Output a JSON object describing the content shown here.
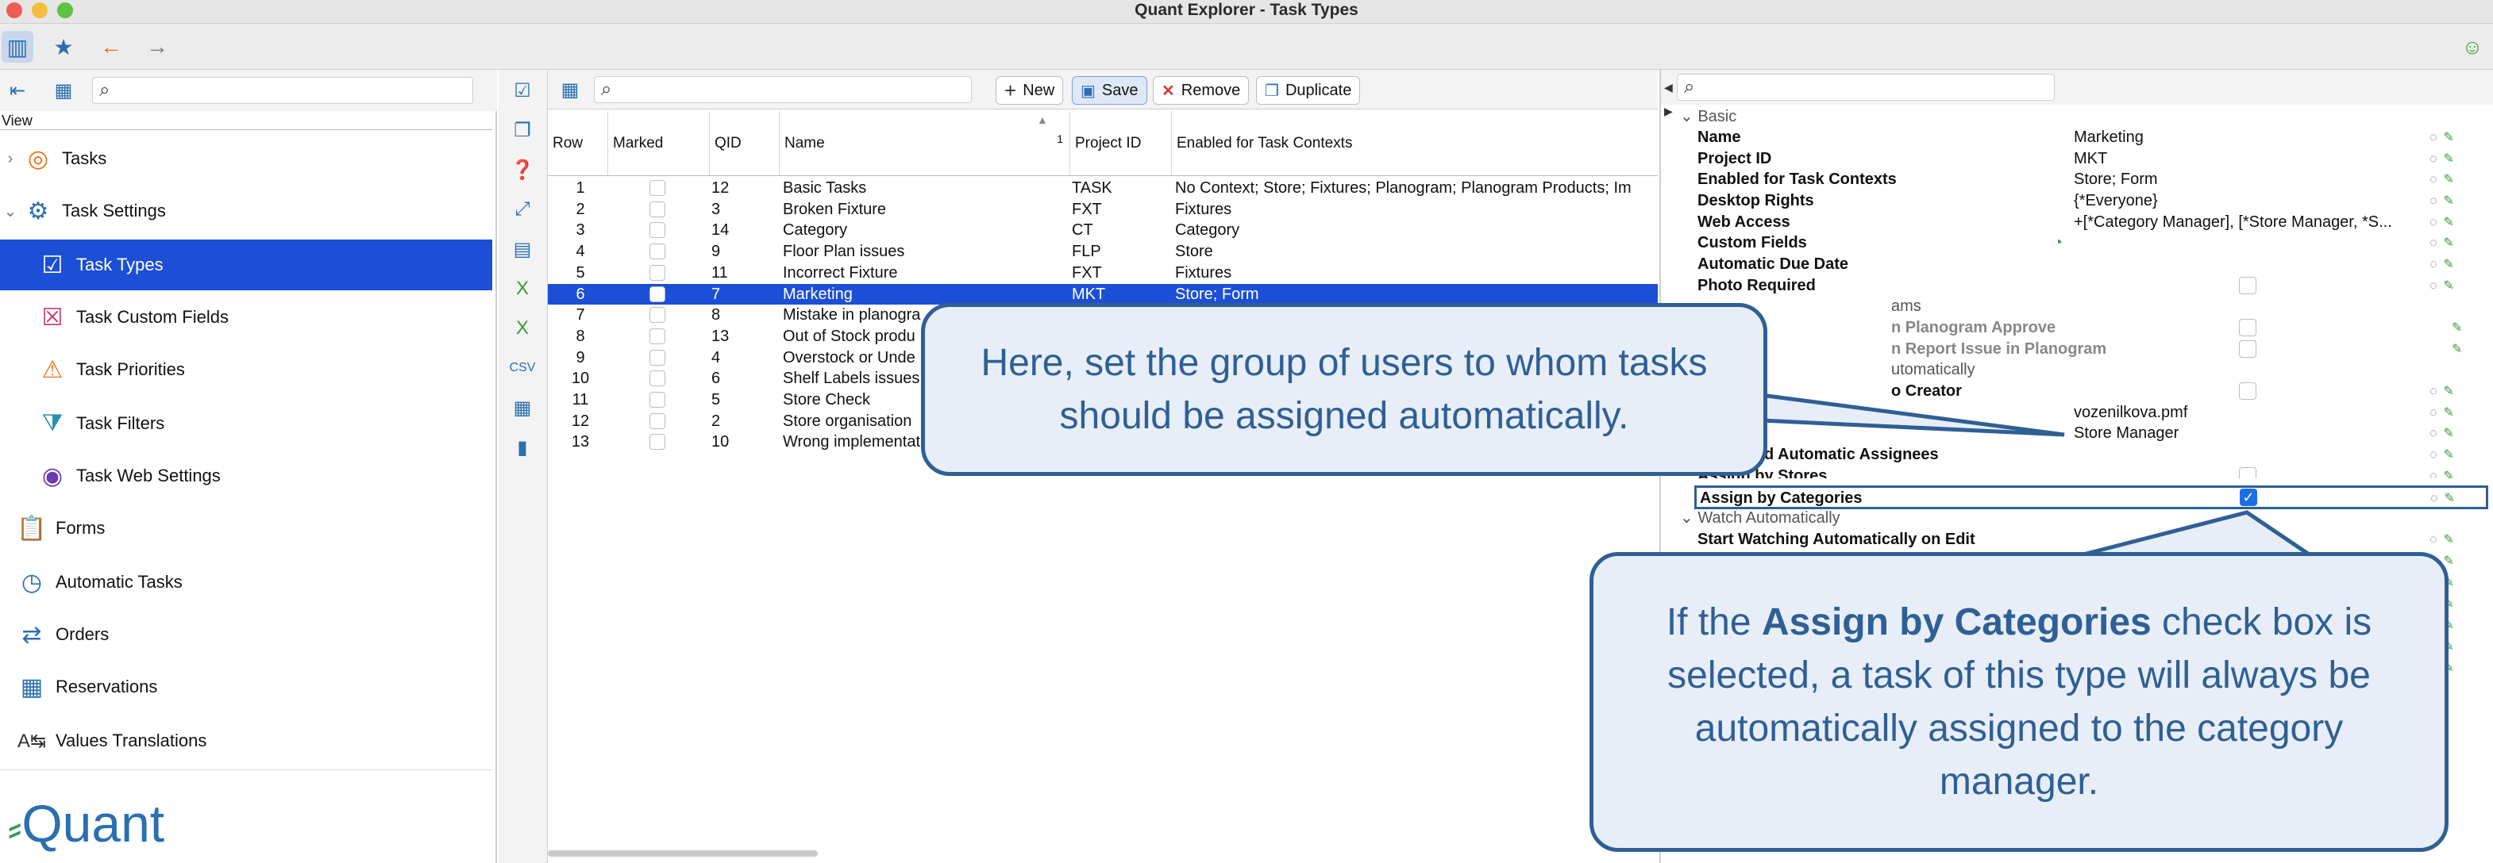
{
  "window": {
    "title": "Quant Explorer - Task Types"
  },
  "left_panel": {
    "view_label": "View",
    "nav": [
      {
        "label": "Tasks",
        "icon": "tasks-icon"
      },
      {
        "label": "Task Settings",
        "icon": "settings-icon"
      },
      {
        "label": "Task Types",
        "icon": "task-types-icon",
        "selected": true
      },
      {
        "label": "Task Custom Fields",
        "icon": "custom-fields-icon"
      },
      {
        "label": "Task Priorities",
        "icon": "priorities-icon"
      },
      {
        "label": "Task Filters",
        "icon": "filter-icon"
      },
      {
        "label": "Task Web Settings",
        "icon": "web-settings-icon"
      },
      {
        "label": "Forms",
        "icon": "forms-icon"
      },
      {
        "label": "Automatic Tasks",
        "icon": "clock-icon"
      },
      {
        "label": "Orders",
        "icon": "orders-icon"
      },
      {
        "label": "Reservations",
        "icon": "calendar-icon"
      },
      {
        "label": "Values Translations",
        "icon": "translate-icon"
      }
    ],
    "logo": "Quant"
  },
  "middle_toolbar": {
    "new": "New",
    "save": "Save",
    "remove": "Remove",
    "duplicate": "Duplicate"
  },
  "grid": {
    "columns": [
      "Row",
      "Marked",
      "QID",
      "Name",
      "Project ID",
      "Enabled for Task Contexts"
    ],
    "sort_index": "1",
    "rows": [
      {
        "row": "1",
        "qid": "12",
        "name": "Basic Tasks",
        "pid": "TASK",
        "ctx": "No Context; Store; Fixtures; Planogram; Planogram Products; Im"
      },
      {
        "row": "2",
        "qid": "3",
        "name": "Broken Fixture",
        "pid": "FXT",
        "ctx": "Fixtures"
      },
      {
        "row": "3",
        "qid": "14",
        "name": "Category",
        "pid": "CT",
        "ctx": "Category"
      },
      {
        "row": "4",
        "qid": "9",
        "name": "Floor Plan issues",
        "pid": "FLP",
        "ctx": "Store"
      },
      {
        "row": "5",
        "qid": "11",
        "name": "Incorrect Fixture",
        "pid": "FXT",
        "ctx": "Fixtures"
      },
      {
        "row": "6",
        "qid": "7",
        "name": "Marketing",
        "pid": "MKT",
        "ctx": "Store; Form",
        "selected": true
      },
      {
        "row": "7",
        "qid": "8",
        "name": "Mistake in planogra",
        "pid": "",
        "ctx": ""
      },
      {
        "row": "8",
        "qid": "13",
        "name": "Out of Stock produ",
        "pid": "",
        "ctx": ""
      },
      {
        "row": "9",
        "qid": "4",
        "name": "Overstock or Unde",
        "pid": "",
        "ctx": ""
      },
      {
        "row": "10",
        "qid": "6",
        "name": "Shelf Labels issues",
        "pid": "",
        "ctx": ""
      },
      {
        "row": "11",
        "qid": "5",
        "name": "Store Check",
        "pid": "",
        "ctx": ""
      },
      {
        "row": "12",
        "qid": "2",
        "name": "Store organisation",
        "pid": "",
        "ctx": ""
      },
      {
        "row": "13",
        "qid": "10",
        "name": "Wrong implementat",
        "pid": "",
        "ctx": ""
      }
    ]
  },
  "properties": {
    "section_basic": "Basic",
    "name_key": "Name",
    "name_val": "Marketing",
    "pid_key": "Project ID",
    "pid_val": "MKT",
    "ctx_key": "Enabled for Task Contexts",
    "ctx_val": "Store; Form",
    "desk_key": "Desktop Rights",
    "desk_val": "{*Everyone}",
    "web_key": "Web Access",
    "web_val": "+[*Category Manager], [*Store Manager, *S...",
    "cf_key": "Custom Fields",
    "due_key": "Automatic Due Date",
    "photo_key": "Photo Required",
    "sec_programs_partial": "ams",
    "plan_approve_partial": "n Planogram Approve",
    "report_issue_partial": "n Report Issue in Planogram",
    "sec_auto_partial": "utomatically",
    "creator_partial": "o Creator",
    "file_val": "vozenilkova.pmf",
    "manager_val": "Store Manager",
    "assignees_partial": "d Automatic Assignees",
    "stores_partial": "Assign by Stores",
    "cat_key": "Assign by Categories",
    "sec_watch": "Watch Automatically",
    "watch_key": "Start Watching Automatically on Edit"
  },
  "callouts": {
    "top": "Here, set the group of users to whom tasks should be assigned automatically.",
    "bottom_pre": "If the ",
    "bottom_bold": "Assign by Categories",
    "bottom_post": " check box is selected, a task of this type will always be automatically assigned to the category manager."
  },
  "colors": {
    "selection": "#1c4fd6",
    "callout_border": "#2f5f94",
    "callout_fill": "#e7eef7"
  }
}
